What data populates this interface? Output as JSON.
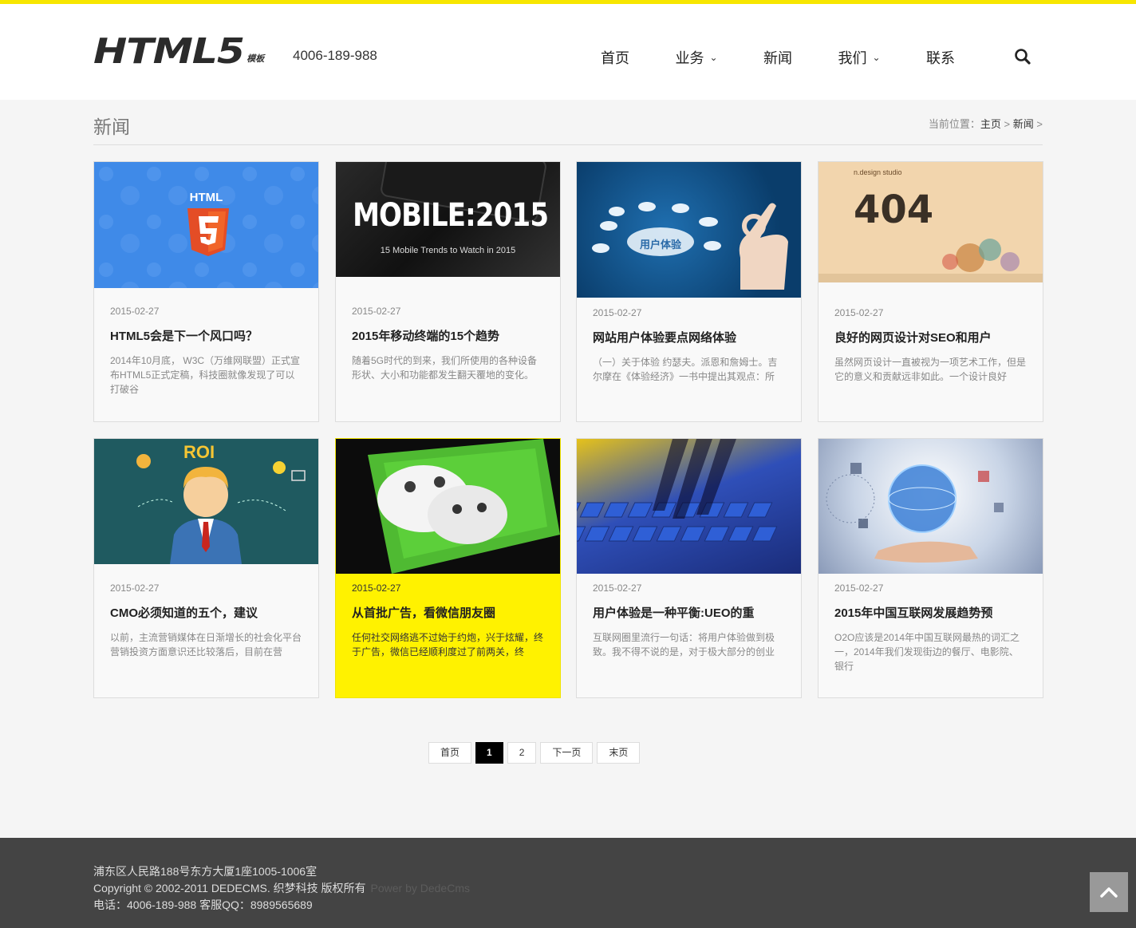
{
  "header": {
    "logo_main": "HTML5",
    "logo_sub": "模板",
    "phone": "4006-189-988",
    "nav": [
      {
        "label": "首页",
        "dropdown": false
      },
      {
        "label": "业务",
        "dropdown": true
      },
      {
        "label": "新闻",
        "dropdown": false
      },
      {
        "label": "我们",
        "dropdown": true
      },
      {
        "label": "联系",
        "dropdown": false
      }
    ]
  },
  "page": {
    "title": "新闻",
    "breadcrumb_prefix": "当前位置：",
    "breadcrumb": [
      "主页",
      "新闻"
    ],
    "sep": ">"
  },
  "articles": [
    {
      "date": "2015-02-27",
      "title": "HTML5会是下一个风口吗？",
      "desc": "2014年10月底， W3C（万维网联盟）正式宣布HTML5正式定稿，科技圈就像发现了可以打破谷",
      "image": "html5",
      "image_text": "HTML"
    },
    {
      "date": "2015-02-27",
      "title": "2015年移动终端的15个趋势",
      "desc": "随着5G时代的到来，我们所使用的各种设备形状、大小和功能都发生翻天覆地的变化。",
      "image": "mobile",
      "image_text": "MOBILE:2015",
      "image_sub": "15 Mobile Trends to Watch in 2015"
    },
    {
      "date": "2015-02-27",
      "title": "网站用户体验要点网络体验",
      "desc": "（一）关于体验 约瑟夫。派恩和詹姆士。吉尔摩在《体验经济》一书中提出其观点：所",
      "image": "ux",
      "image_text": "用户体验"
    },
    {
      "date": "2015-02-27",
      "title": "良好的网页设计对SEO和用户",
      "desc": "虽然网页设计一直被视为一项艺术工作，但是它的意义和贡献远非如此。一个设计良好",
      "image": "404",
      "image_text": "404",
      "image_sub": "n.design studio"
    },
    {
      "date": "2015-02-27",
      "title": "CMO必须知道的五个，建议",
      "desc": "以前，主流营销媒体在日渐增长的社会化平台营销投资方面意识还比较落后，目前在营",
      "image": "roi",
      "image_text": "ROI"
    },
    {
      "date": "2015-02-27",
      "title": "从首批广告，看微信朋友圈",
      "desc": "任何社交网络逃不过始于约炮，兴于炫耀，终于广告，微信已经顺利度过了前两关，终",
      "image": "wechat",
      "highlight": true
    },
    {
      "date": "2015-02-27",
      "title": "用户体验是一种平衡:UEO的重",
      "desc": "互联网圈里流行一句话：将用户体验做到极致。我不得不说的是，对于极大部分的创业",
      "image": "keyboard"
    },
    {
      "date": "2015-02-27",
      "title": "2015年中国互联网发展趋势预",
      "desc": "O2O应该是2014年中国互联网最热的词汇之一，2014年我们发现街边的餐厅、电影院、银行",
      "image": "globe"
    }
  ],
  "pager": {
    "first": "首页",
    "pages": [
      "1",
      "2"
    ],
    "current": "1",
    "next": "下一页",
    "last": "末页"
  },
  "footer": {
    "address": "浦东区人民路188号东方大厦1座1005-1006室",
    "copyright": "Copyright © 2002-2011 DEDECMS. 织梦科技 版权所有",
    "power": "Power by DedeCms",
    "contact": "电话：4006-189-988 客服QQ：8989565689"
  },
  "colors": {
    "accent": "#fff200",
    "footer": "#444444"
  }
}
